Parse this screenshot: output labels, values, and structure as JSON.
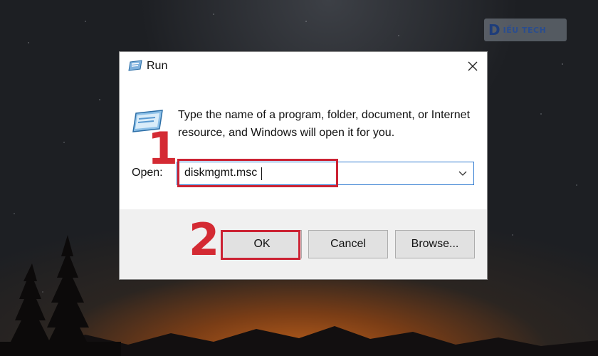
{
  "watermark": {
    "logo_letter": "D",
    "logo_text": "IẾU TECH"
  },
  "run_dialog": {
    "title": "Run",
    "description": "Type the name of a program, folder, document, or Internet resource, and Windows will open it for you.",
    "open_label": "Open:",
    "open_value": "diskmgmt.msc",
    "buttons": {
      "ok": "OK",
      "cancel": "Cancel",
      "browse": "Browse..."
    }
  },
  "annotations": {
    "step1": "1",
    "step2": "2",
    "highlight_color": "#cc2233"
  },
  "icons": [
    "run-title-icon",
    "close-icon",
    "run-program-icon",
    "chevron-down-icon"
  ]
}
